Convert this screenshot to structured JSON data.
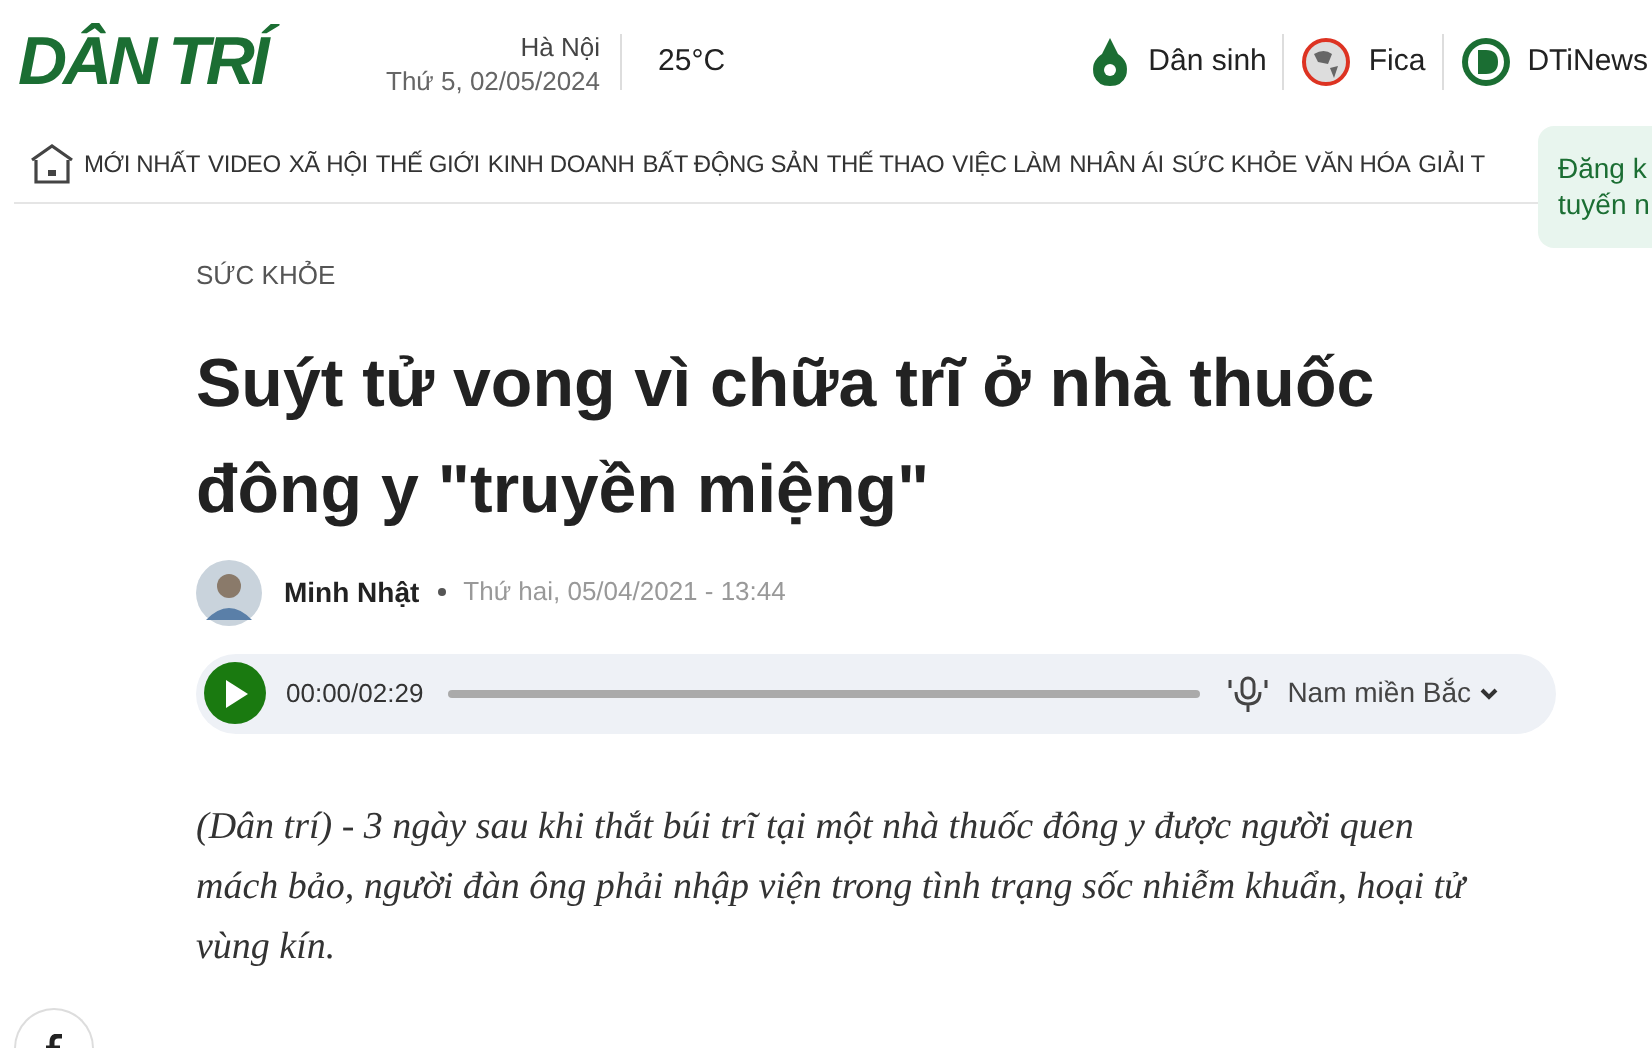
{
  "header": {
    "logo": "DÂN TRÍ",
    "city": "Hà Nội",
    "date": "Thứ 5, 02/05/2024",
    "temperature": "25°C",
    "links": [
      {
        "label": "Dân sinh",
        "kind": "pen"
      },
      {
        "label": "Fica",
        "kind": "globe"
      },
      {
        "label": "DTiNews",
        "kind": "d"
      }
    ]
  },
  "nav": {
    "items": [
      "MỚI NHẤT",
      "VIDEO",
      "XÃ HỘI",
      "THẾ GIỚI",
      "KINH DOANH",
      "BẤT ĐỘNG SẢN",
      "THẾ THAO",
      "VIỆC LÀM",
      "NHÂN ÁI",
      "SỨC KHỎE",
      "VĂN HÓA",
      "GIẢI T"
    ]
  },
  "popup": {
    "lines": [
      "Đăng k",
      "tuyến n"
    ]
  },
  "article": {
    "category": "SỨC KHỎE",
    "title": "Suýt tử vong vì chữa trĩ ở nhà thuốc đông y \"truyền miệng\"",
    "author": "Minh Nhật",
    "published": "Thứ hai, 05/04/2021 - 13:44",
    "audio": {
      "time": "00:00/02:29",
      "voice": "Nam miền Bắc"
    },
    "sapo": "(Dân trí) - 3 ngày sau khi thắt búi trĩ tại một nhà thuốc đông y được người quen mách bảo, người đàn ông phải nhập viện trong tình trạng sốc nhiễm khuẩn, hoại tử vùng kín."
  }
}
